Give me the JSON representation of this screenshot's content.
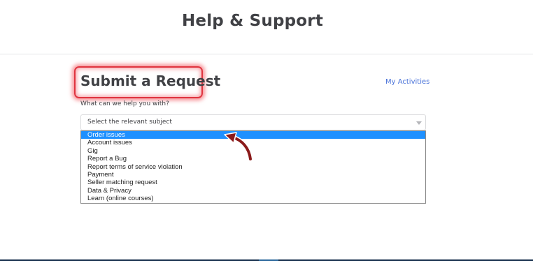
{
  "header": {
    "title": "Help & Support"
  },
  "form": {
    "title": "Submit a Request",
    "activities_link": "My Activities",
    "question": "What can we help you with?",
    "select": {
      "placeholder": "Select the relevant subject"
    },
    "options": [
      "Order issues",
      "Account issues",
      "Gig",
      "Report a Bug",
      "Report terms of service violation",
      "Payment",
      "Seller matching request",
      "Data & Privacy",
      "Learn (online courses)"
    ],
    "highlighted_option": "Order issues"
  },
  "annotations": {
    "highlight_color": "#e0343f",
    "arrow_color": "#8b1a1a"
  },
  "colors": {
    "selected_option": "#1e90ff",
    "link": "#4a73d9",
    "text": "#404145"
  }
}
